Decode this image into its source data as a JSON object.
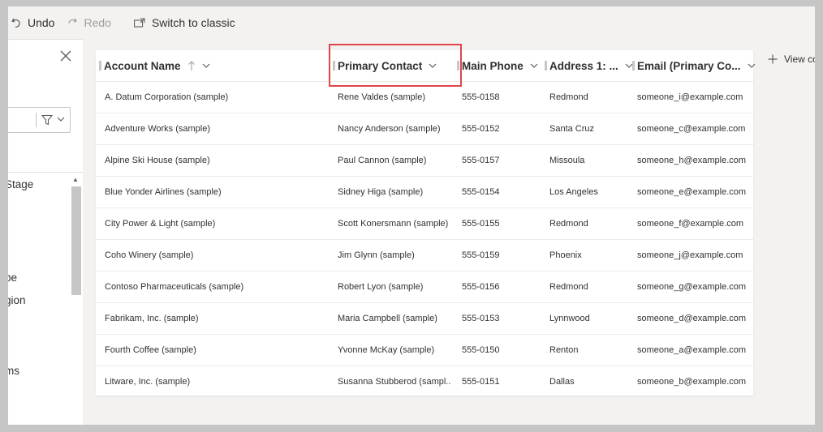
{
  "toolbar": {
    "undo_label": "Undo",
    "redo_label": "Redo",
    "switch_label": "Switch to classic"
  },
  "left_pane": {
    "fields": [
      "Stage",
      "pe",
      "gion",
      "ms"
    ]
  },
  "grid": {
    "columns": [
      {
        "label": "Account Name",
        "sort": "ascending"
      },
      {
        "label": "Primary Contact"
      },
      {
        "label": "Main Phone"
      },
      {
        "label": "Address 1: ..."
      },
      {
        "label": "Email (Primary Co..."
      }
    ],
    "rows": [
      [
        "A. Datum Corporation (sample)",
        "Rene Valdes (sample)",
        "555-0158",
        "Redmond",
        "someone_i@example.com"
      ],
      [
        "Adventure Works (sample)",
        "Nancy Anderson (sample)",
        "555-0152",
        "Santa Cruz",
        "someone_c@example.com"
      ],
      [
        "Alpine Ski House (sample)",
        "Paul Cannon (sample)",
        "555-0157",
        "Missoula",
        "someone_h@example.com"
      ],
      [
        "Blue Yonder Airlines (sample)",
        "Sidney Higa (sample)",
        "555-0154",
        "Los Angeles",
        "someone_e@example.com"
      ],
      [
        "City Power & Light (sample)",
        "Scott Konersmann (sample)",
        "555-0155",
        "Redmond",
        "someone_f@example.com"
      ],
      [
        "Coho Winery (sample)",
        "Jim Glynn (sample)",
        "555-0159",
        "Phoenix",
        "someone_j@example.com"
      ],
      [
        "Contoso Pharmaceuticals (sample)",
        "Robert Lyon (sample)",
        "555-0156",
        "Redmond",
        "someone_g@example.com"
      ],
      [
        "Fabrikam, Inc. (sample)",
        "Maria Campbell (sample)",
        "555-0153",
        "Lynnwood",
        "someone_d@example.com"
      ],
      [
        "Fourth Coffee (sample)",
        "Yvonne McKay (sample)",
        "555-0150",
        "Renton",
        "someone_a@example.com"
      ],
      [
        "Litware, Inc. (sample)",
        "Susanna Stubberod (sampl...",
        "555-0151",
        "Dallas",
        "someone_b@example.com"
      ]
    ]
  },
  "view_column_label": "View co",
  "colors": {
    "highlight": "#e0454a",
    "accent": "#323130"
  }
}
